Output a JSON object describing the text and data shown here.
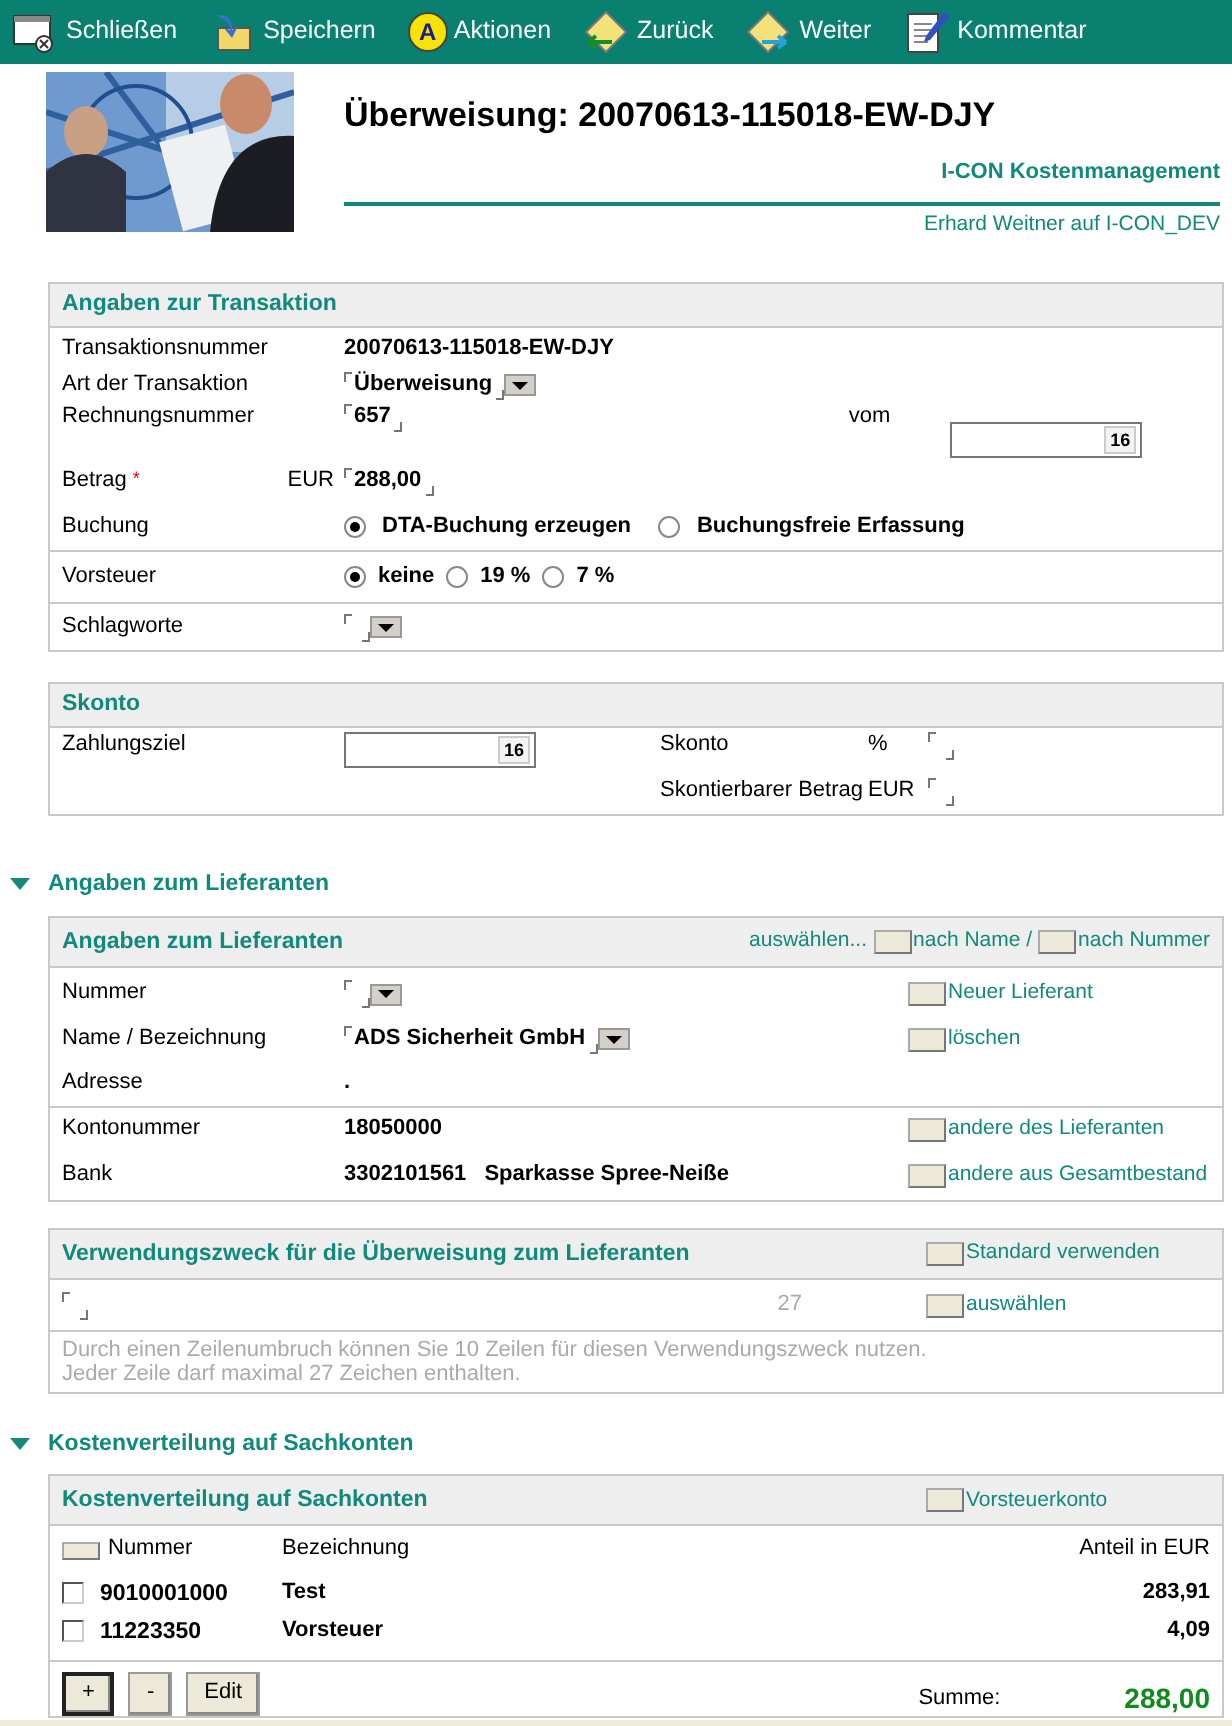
{
  "toolbar": [
    {
      "label": "Schließen"
    },
    {
      "label": "Speichern"
    },
    {
      "label": "Aktionen",
      "badge": "A"
    },
    {
      "label": "Zurück"
    },
    {
      "label": "Weiter"
    },
    {
      "label": "Kommentar"
    }
  ],
  "header": {
    "title": "Überweisung: 20070613-115018-EW-DJY",
    "app_name": "I-CON Kostenmanagement",
    "user_line": "Erhard Weitner auf I-CON_DEV"
  },
  "transaction": {
    "heading": "Angaben zur Transaktion",
    "number": {
      "label": "Transaktionsnummer",
      "value": "20070613-115018-EW-DJY"
    },
    "type": {
      "label": "Art der Transaktion",
      "value": "Überweisung"
    },
    "invoice": {
      "label": "Rechnungsnummer",
      "value": "657",
      "date_label": "vom",
      "calendar": "16"
    },
    "amount": {
      "label": "Betrag",
      "required_mark": "*",
      "currency": "EUR",
      "value": "288,00"
    },
    "booking": {
      "label": "Buchung",
      "options": [
        {
          "label": "DTA-Buchung erzeugen",
          "selected": true
        },
        {
          "label": "Buchungsfreie Erfassung",
          "selected": false
        }
      ]
    },
    "tax": {
      "label": "Vorsteuer",
      "options": [
        {
          "label": "keine",
          "selected": true
        },
        {
          "label": "19 %",
          "selected": false
        },
        {
          "label": "7 %",
          "selected": false
        }
      ]
    },
    "keywords": {
      "label": "Schlagworte"
    }
  },
  "discount": {
    "heading": "Skonto",
    "due": {
      "label": "Zahlungsziel",
      "calendar": "16"
    },
    "rate": {
      "label": "Skonto",
      "unit": "%"
    },
    "base": {
      "label": "Skontierbarer Betrag",
      "unit": "EUR"
    }
  },
  "supplier": {
    "title": "Angaben zum Lieferanten",
    "expanded": true,
    "heading": "Angaben zum Lieferanten",
    "select_label": "auswählen...",
    "select_links": [
      "nach Name /",
      "nach Nummer"
    ],
    "number": {
      "label": "Nummer"
    },
    "name": {
      "label": "Name / Bezeichnung",
      "value": "ADS Sicherheit GmbH"
    },
    "address": {
      "label": "Adresse",
      "value": "."
    },
    "account": {
      "label": "Kontonummer",
      "value": "18050000"
    },
    "bank": {
      "label": "Bank",
      "code": "3302101561",
      "name": "Sparkasse Spree-Neiße"
    },
    "actions": [
      "Neuer Lieferant",
      "löschen",
      "andere des Lieferanten",
      "andere aus Gesamtbestand"
    ]
  },
  "purpose": {
    "heading": "Verwendungszweck für die Überweisung zum Lieferanten",
    "standard_link": "Standard verwenden",
    "counter": "27",
    "select_link": "auswählen",
    "hint": "Durch einen Zeilenumbruch können Sie 10 Zeilen für diesen Verwendungszweck nutzen.\nJeder Zeile darf maximal 27 Zeichen enthalten."
  },
  "costs": {
    "title": "Kostenverteilung auf Sachkonten",
    "expanded": true,
    "heading": "Kostenverteilung auf Sachkonten",
    "tax_account_link": "Vorsteuerkonto",
    "columns": [
      "Nummer",
      "Bezeichnung",
      "Anteil in EUR"
    ],
    "rows": [
      {
        "number": "9010001000",
        "name": "Test",
        "amount": "283,91",
        "checked": false
      },
      {
        "number": "11223350",
        "name": "Vorsteuer",
        "amount": "4,09",
        "checked": false
      }
    ],
    "buttons": [
      {
        "label": "+",
        "focused": true
      },
      {
        "label": "-",
        "focused": false
      },
      {
        "label": "Edit",
        "focused": false
      }
    ],
    "sum_label": "Summe:",
    "sum": "288,00"
  }
}
